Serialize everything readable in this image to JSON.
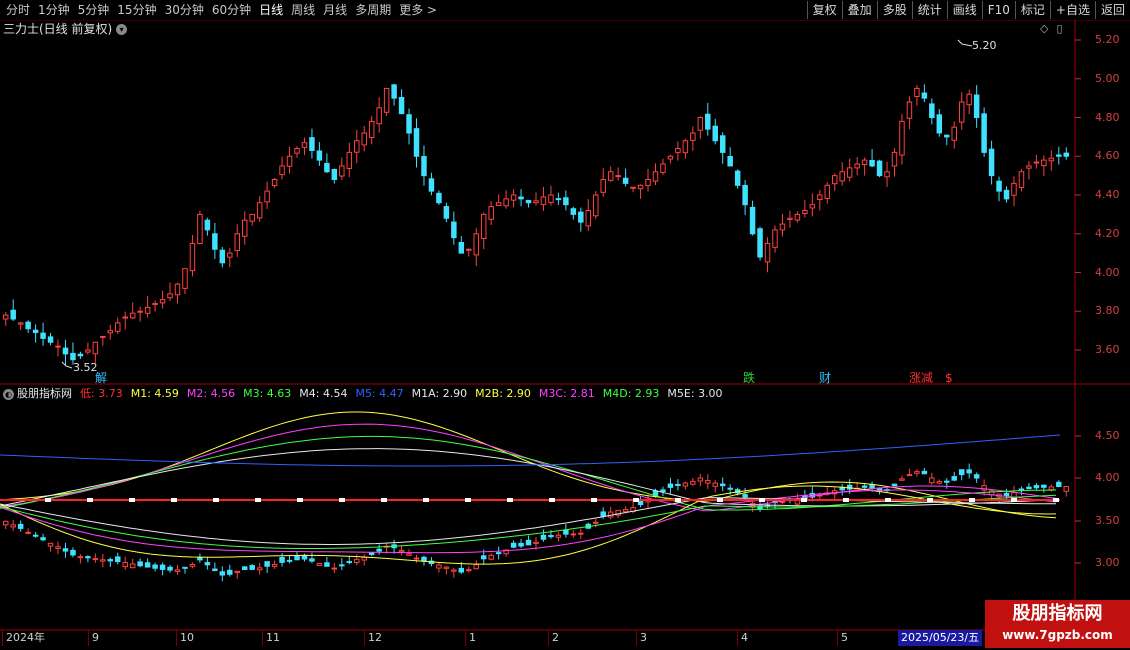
{
  "toolbar": {
    "periods": [
      "分时",
      "1分钟",
      "5分钟",
      "15分钟",
      "30分钟",
      "60分钟",
      "日线",
      "周线",
      "月线",
      "多周期",
      "更多 >"
    ],
    "active_index": 6,
    "right_buttons": [
      "复权",
      "叠加",
      "多股",
      "统计",
      "画线",
      "F10",
      "标记",
      "+自选",
      "返回"
    ]
  },
  "stock": {
    "title": "三力士(日线 前复权)",
    "toggle_glyph": "▾"
  },
  "corner_icons": {
    "diamond": "◇",
    "window": "▯"
  },
  "main_chart": {
    "y_labels": [
      "5.20",
      "5.00",
      "4.80",
      "4.60",
      "4.40",
      "4.20",
      "4.00",
      "3.80",
      "3.60"
    ],
    "high_label": "5.20",
    "low_label": "3.52",
    "events": [
      {
        "text": "解",
        "color": "#30c0ff"
      },
      {
        "text": "跌",
        "color": "#30d030"
      },
      {
        "text": "财",
        "color": "#30c0ff"
      },
      {
        "text": "涨减",
        "color": "#ff3030"
      },
      {
        "text": "$",
        "color": "#ff3030"
      }
    ]
  },
  "indicator": {
    "name": "股朋指标网",
    "items": [
      {
        "label": "低: 3.73",
        "color": "#ff3030"
      },
      {
        "label": "M1: 4.59",
        "color": "#ffff40"
      },
      {
        "label": "M2: 4.56",
        "color": "#ff40ff"
      },
      {
        "label": "M3: 4.63",
        "color": "#40ff40"
      },
      {
        "label": "M4: 4.54",
        "color": "#e8e8e8"
      },
      {
        "label": "M5: 4.47",
        "color": "#3060ff"
      },
      {
        "label": "M1A: 2.90",
        "color": "#e8e8e8"
      },
      {
        "label": "M2B: 2.90",
        "color": "#ffff40"
      },
      {
        "label": "M3C: 2.81",
        "color": "#ff40ff"
      },
      {
        "label": "M4D: 2.93",
        "color": "#40ff40"
      },
      {
        "label": "M5E: 3.00",
        "color": "#e8e8e8"
      }
    ],
    "y_labels": [
      "4.50",
      "4.00",
      "3.50",
      "3.00"
    ]
  },
  "dates": [
    "2024年",
    "9",
    "10",
    "11",
    "12",
    "1",
    "2",
    "3",
    "4",
    "5"
  ],
  "current_date": "2025/05/23/五",
  "watermark": {
    "line1": "股朋指标网",
    "line2": "www.7gpzb.com"
  },
  "chart_data": {
    "type": "candlestick",
    "y_range": [
      3.48,
      5.28
    ],
    "close_series": [
      3.78,
      3.76,
      3.74,
      3.71,
      3.69,
      3.66,
      3.64,
      3.62,
      3.58,
      3.55,
      3.57,
      3.6,
      3.64,
      3.67,
      3.7,
      3.74,
      3.77,
      3.79,
      3.8,
      3.82,
      3.84,
      3.86,
      3.89,
      3.94,
      4.02,
      4.15,
      4.3,
      4.22,
      4.12,
      4.05,
      4.1,
      4.2,
      4.27,
      4.3,
      4.36,
      4.42,
      4.48,
      4.55,
      4.6,
      4.64,
      4.67,
      4.63,
      4.58,
      4.52,
      4.48,
      4.55,
      4.62,
      4.68,
      4.72,
      4.78,
      4.85,
      4.95,
      4.9,
      4.82,
      4.72,
      4.6,
      4.5,
      4.42,
      4.36,
      4.28,
      4.18,
      4.1,
      4.12,
      4.2,
      4.3,
      4.34,
      4.36,
      4.38,
      4.4,
      4.38,
      4.36,
      4.37,
      4.39,
      4.4,
      4.38,
      4.35,
      4.3,
      4.26,
      4.32,
      4.4,
      4.48,
      4.52,
      4.5,
      4.46,
      4.44,
      4.45,
      4.48,
      4.52,
      4.56,
      4.6,
      4.64,
      4.68,
      4.72,
      4.8,
      4.74,
      4.68,
      4.62,
      4.55,
      4.45,
      4.35,
      4.2,
      4.08,
      4.15,
      4.22,
      4.25,
      4.28,
      4.3,
      4.32,
      4.35,
      4.4,
      4.45,
      4.5,
      4.52,
      4.54,
      4.56,
      4.58,
      4.55,
      4.5,
      4.52,
      4.62,
      4.78,
      4.88,
      4.95,
      4.9,
      4.8,
      4.72,
      4.7,
      4.75,
      4.88,
      4.92,
      4.8,
      4.62,
      4.5,
      4.42,
      4.38,
      4.46,
      4.52,
      4.55,
      4.57,
      4.58,
      4.59,
      4.6,
      4.6
    ]
  }
}
